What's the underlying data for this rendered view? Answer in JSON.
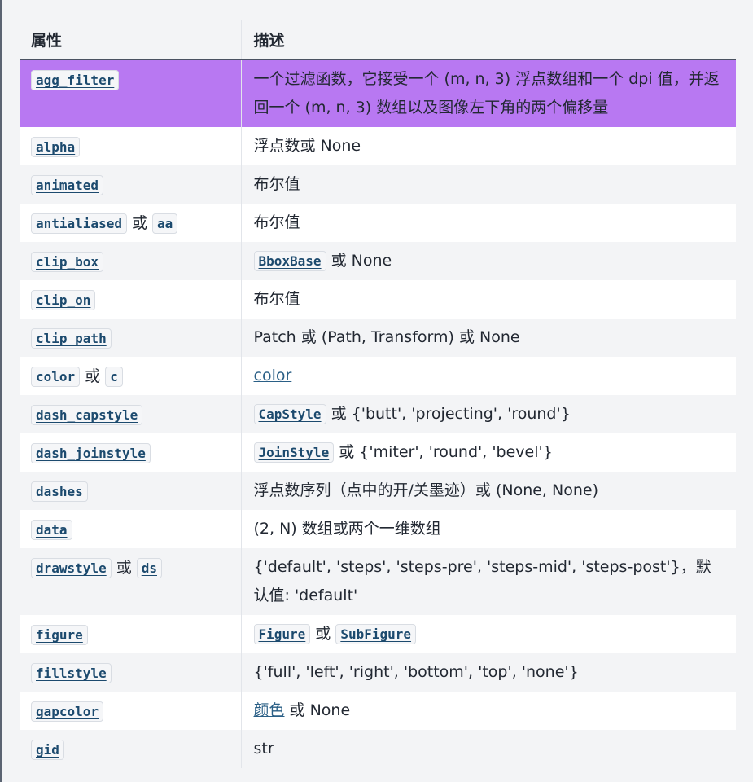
{
  "table": {
    "headers": [
      "属性",
      "描述"
    ],
    "rows": [
      {
        "attr": [
          "agg_filter"
        ],
        "desc": "一个过滤函数，它接受一个 (m, n, 3) 浮点数组和一个 dpi 值，并返回一个 (m, n, 3) 数组以及图像左下角的两个偏移量",
        "highlight": true
      },
      {
        "attr": [
          "alpha"
        ],
        "desc": "浮点数或 None"
      },
      {
        "attr": [
          "animated"
        ],
        "desc": "布尔值"
      },
      {
        "attr": [
          "antialiased",
          "aa"
        ],
        "desc": "布尔值"
      },
      {
        "attr": [
          "clip_box"
        ],
        "desc_code": "BboxBase",
        "desc": " 或 None"
      },
      {
        "attr": [
          "clip_on"
        ],
        "desc": "布尔值"
      },
      {
        "attr": [
          "clip_path"
        ],
        "desc": "Patch 或 (Path, Transform) 或 None"
      },
      {
        "attr": [
          "color",
          "c"
        ],
        "desc_link": "color"
      },
      {
        "attr": [
          "dash_capstyle"
        ],
        "desc_code": "CapStyle",
        "desc": " 或 {'butt', 'projecting', 'round'}"
      },
      {
        "attr": [
          "dash_joinstyle"
        ],
        "desc_code": "JoinStyle",
        "desc": " 或 {'miter', 'round', 'bevel'}"
      },
      {
        "attr": [
          "dashes"
        ],
        "desc": "浮点数序列（点中的开/关墨迹）或 (None, None)"
      },
      {
        "attr": [
          "data"
        ],
        "desc": "(2, N) 数组或两个一维数组"
      },
      {
        "attr": [
          "drawstyle",
          "ds"
        ],
        "desc": "{'default', 'steps', 'steps-pre', 'steps-mid', 'steps-post'}，默认值: 'default'"
      },
      {
        "attr": [
          "figure"
        ],
        "desc_code": "Figure",
        "desc_code2": "SubFigure"
      },
      {
        "attr": [
          "fillstyle"
        ],
        "desc": "{'full', 'left', 'right', 'bottom', 'top', 'none'}"
      },
      {
        "attr": [
          "gapcolor"
        ],
        "desc_link": "颜色",
        "desc": " 或 None"
      },
      {
        "attr": [
          "gid"
        ],
        "desc": "str"
      }
    ]
  },
  "or_word": "或"
}
